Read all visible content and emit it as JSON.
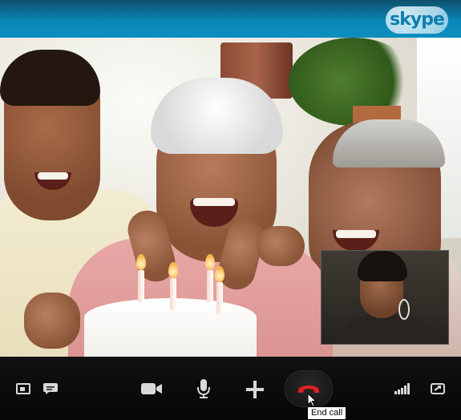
{
  "app": {
    "logo_text": "skype",
    "brand_color": "#0a87b7"
  },
  "video": {
    "main_feed": "remote-video",
    "self_view": "local-video"
  },
  "toolbar": {
    "buttons": [
      {
        "id": "screen-share",
        "icon": "screen-icon"
      },
      {
        "id": "chat",
        "icon": "chat-bubble-icon"
      },
      {
        "id": "video",
        "icon": "video-camera-icon"
      },
      {
        "id": "mic",
        "icon": "microphone-icon"
      },
      {
        "id": "add",
        "icon": "plus-icon"
      },
      {
        "id": "end-call",
        "icon": "phone-hangup-icon",
        "accent": "#e12020"
      },
      {
        "id": "signal",
        "icon": "signal-bars-icon"
      },
      {
        "id": "fullscreen",
        "icon": "fullscreen-icon"
      }
    ],
    "tooltip": "End call"
  }
}
